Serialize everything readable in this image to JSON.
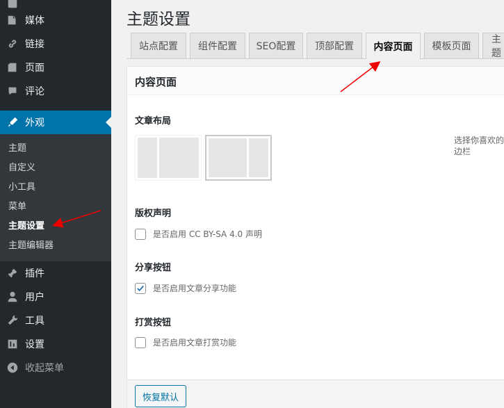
{
  "sidebar": {
    "items": [
      {
        "label": "媒体",
        "icon": "media-icon"
      },
      {
        "label": "链接",
        "icon": "link-icon"
      },
      {
        "label": "页面",
        "icon": "page-icon"
      },
      {
        "label": "评论",
        "icon": "comment-icon"
      },
      {
        "label": "外观",
        "icon": "appearance-icon"
      },
      {
        "label": "插件",
        "icon": "plugin-icon"
      },
      {
        "label": "用户",
        "icon": "user-icon"
      },
      {
        "label": "工具",
        "icon": "tools-icon"
      },
      {
        "label": "设置",
        "icon": "settings-icon"
      },
      {
        "label": "收起菜单",
        "icon": "collapse-icon"
      }
    ],
    "submenu": [
      "主题",
      "自定义",
      "小工具",
      "菜单",
      "主题设置",
      "主题编辑器"
    ],
    "active_color": "#0073aa"
  },
  "page": {
    "title": "主题设置",
    "tabs": [
      "站点配置",
      "组件配置",
      "SEO配置",
      "顶部配置",
      "内容页面",
      "模板页面",
      "主题"
    ],
    "active_tab": "内容页面"
  },
  "panel": {
    "title": "内容页面",
    "layout_label": "文章布局",
    "layout_hint": "选择你喜欢的右边栏",
    "copyright_label": "版权声明",
    "copyright_option": "是否启用 CC BY-SA 4.0 声明",
    "copyright_checked": false,
    "share_label": "分享按钮",
    "share_option": "是否启用文章分享功能",
    "share_checked": true,
    "reward_label": "打赏按钮",
    "reward_option": "是否启用文章打赏功能",
    "reward_checked": false,
    "reset_button": "恢复默认"
  }
}
